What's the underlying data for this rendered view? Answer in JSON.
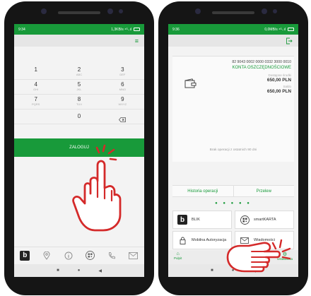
{
  "left_phone": {
    "status": {
      "time": "9:34",
      "network": "1,3KB/s ⁴ᴳ..ıl"
    },
    "keypad": [
      [
        {
          "digit": "1",
          "letters": ""
        },
        {
          "digit": "2",
          "letters": "ABC"
        },
        {
          "digit": "3",
          "letters": "DEF"
        }
      ],
      [
        {
          "digit": "4",
          "letters": "GHI"
        },
        {
          "digit": "5",
          "letters": "JKL"
        },
        {
          "digit": "6",
          "letters": "MNO"
        }
      ],
      [
        {
          "digit": "7",
          "letters": "PQRS"
        },
        {
          "digit": "8",
          "letters": "TUV"
        },
        {
          "digit": "9",
          "letters": "WXYZ"
        }
      ]
    ],
    "zero": "0",
    "login_label": "ZALOGUJ",
    "bottom_icons": [
      "blik-icon",
      "location-icon",
      "info-icon",
      "qr-icon",
      "phone-icon",
      "mail-icon"
    ]
  },
  "right_phone": {
    "status": {
      "time": "9:36",
      "network": "0,0MB/s ⁴ᴳ..ıl"
    },
    "account": {
      "number": "82 9043 0002 0000 0332 3000 0010",
      "name": "KONTA OSZCZĘDNOŚCIOWE",
      "label_available": "Dostępne środki",
      "available": "650,00 PLN",
      "label_balance": "Saldo",
      "balance": "650,00 PLN"
    },
    "no_operations": "Brak operacji z ostatnich 90 dni",
    "tabs": [
      "Historia operacji",
      "Przelew"
    ],
    "tiles": {
      "blik": "BLIK",
      "smartkarta": "smartKARTA",
      "mobile_auth": "Mobilna Autoryzacja",
      "messages": "Wiadomości"
    },
    "nav": {
      "home": "Pulpit",
      "settings": "Ustawienia"
    }
  },
  "colors": {
    "brand": "#189a3a",
    "hand": "#d42a2a"
  }
}
